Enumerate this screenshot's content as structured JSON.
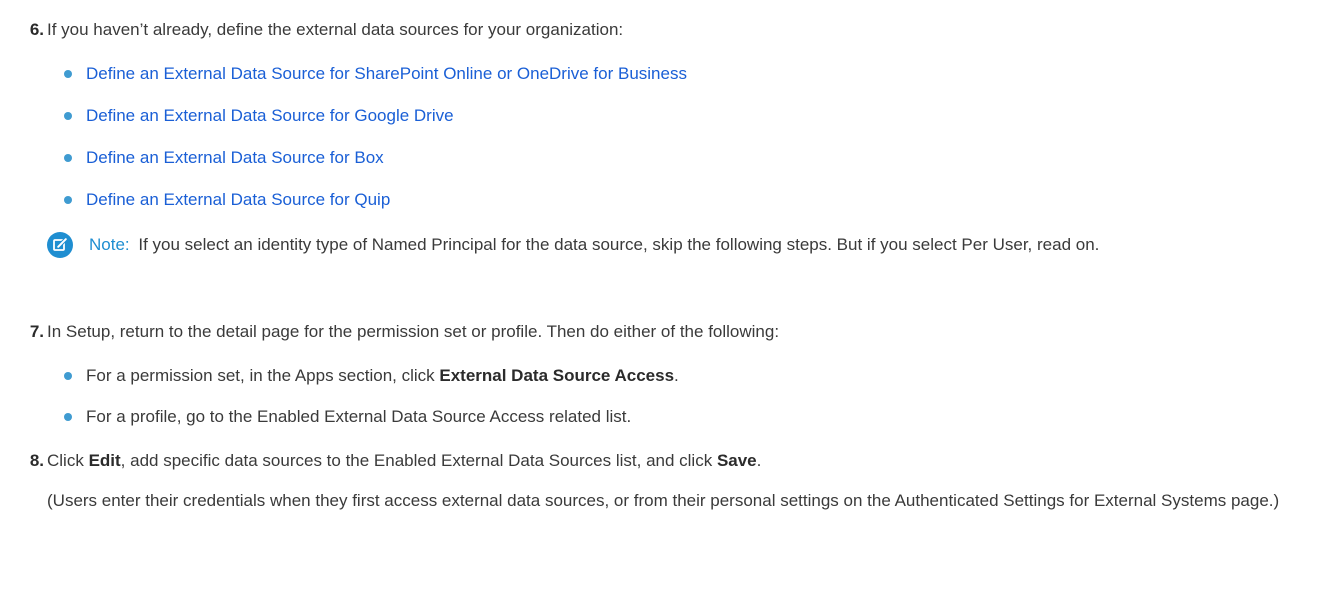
{
  "step6": {
    "number": "6.",
    "text": "If you haven’t already, define the external data sources for your organization:",
    "links": [
      "Define an External Data Source for SharePoint Online or OneDrive for Business",
      "Define an External Data Source for Google Drive",
      "Define an External Data Source for Box",
      "Define an External Data Source for Quip"
    ]
  },
  "note": {
    "icon": "edit-note-icon",
    "label": "Note:",
    "text": "If you select an identity type of Named Principal for the data source, skip the following steps. But if you select Per User, read on."
  },
  "step7": {
    "number": "7.",
    "text": "In Setup, return to the detail page for the permission set or profile. Then do either of the following:",
    "bullet1_pre": "For a permission set, in the Apps section, click ",
    "bullet1_bold": "External Data Source Access",
    "bullet1_post": ".",
    "bullet2": "For a profile, go to the Enabled External Data Source Access related list."
  },
  "step8": {
    "number": "8.",
    "text_pre": "Click ",
    "text_bold1": "Edit",
    "text_mid": ", add specific data sources to the Enabled External Data Sources list, and click ",
    "text_bold2": "Save",
    "text_post": ".",
    "para": "(Users enter their credentials when they first access external data sources, or from their personal settings on the Authenticated Settings for External Systems page.)"
  },
  "colors": {
    "link": "#1a5fd6",
    "bullet": "#3f9bd1",
    "note_label": "#1f8ed1",
    "text": "#3a3a3a"
  }
}
